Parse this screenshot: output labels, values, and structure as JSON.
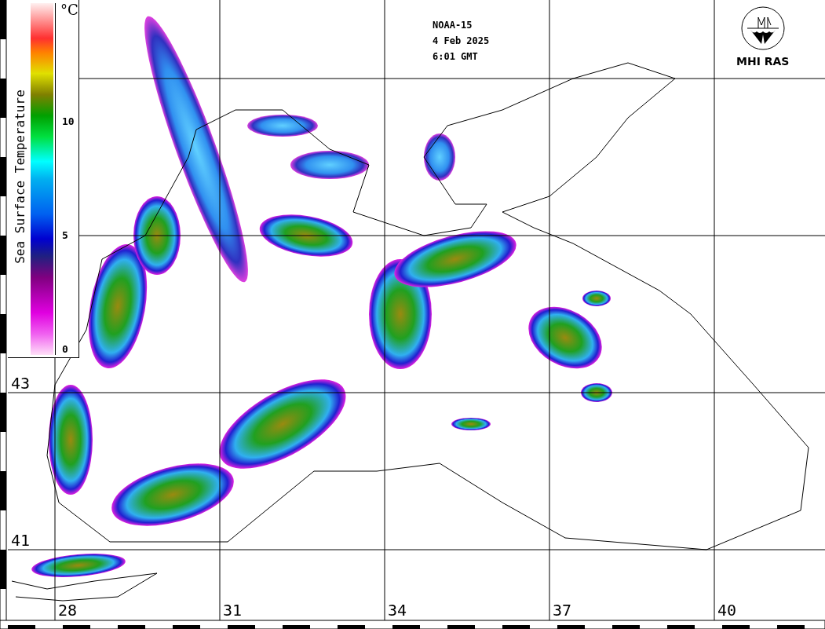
{
  "header": {
    "satellite": "NOAA-15",
    "date": "4 Feb 2025",
    "time": "6:01 GMT"
  },
  "logo": {
    "label": "MHI RAS"
  },
  "colorbar": {
    "title": "Sea Surface Temperature",
    "unit": "°C",
    "ticks": [
      "10",
      "5",
      "0"
    ]
  },
  "map": {
    "lon_labels": [
      "28",
      "31",
      "34",
      "37",
      "40"
    ],
    "lat_labels": [
      "43",
      "41"
    ]
  }
}
